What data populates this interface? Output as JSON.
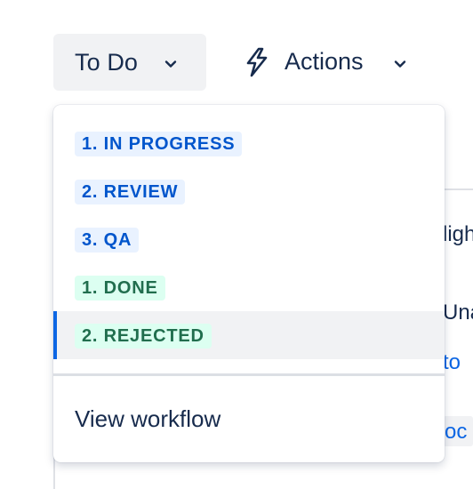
{
  "header": {
    "status_label": "To Do",
    "actions_label": "Actions"
  },
  "background": {
    "lines": [
      "ligh",
      "Una",
      "to",
      "oc"
    ]
  },
  "dropdown": {
    "items": [
      {
        "label": "1. IN PROGRESS",
        "category": "blue",
        "selected": false
      },
      {
        "label": "2. REVIEW",
        "category": "blue",
        "selected": false
      },
      {
        "label": "3. QA",
        "category": "blue",
        "selected": false
      },
      {
        "label": "1. DONE",
        "category": "green",
        "selected": false
      },
      {
        "label": "2. REJECTED",
        "category": "green",
        "selected": true
      }
    ],
    "footer_label": "View workflow"
  },
  "colors": {
    "accent": "#0c66e4",
    "text": "#172b4d",
    "blue_lozenge_bg": "#e9f2ff",
    "blue_lozenge_text": "#0055cc",
    "green_lozenge_bg": "#dcfff1",
    "green_lozenge_text": "#216e4e"
  },
  "icons": {
    "status_chevron": "chevron-down-icon",
    "actions_icon": "lightning-bolt-icon",
    "actions_chevron": "chevron-down-icon"
  }
}
